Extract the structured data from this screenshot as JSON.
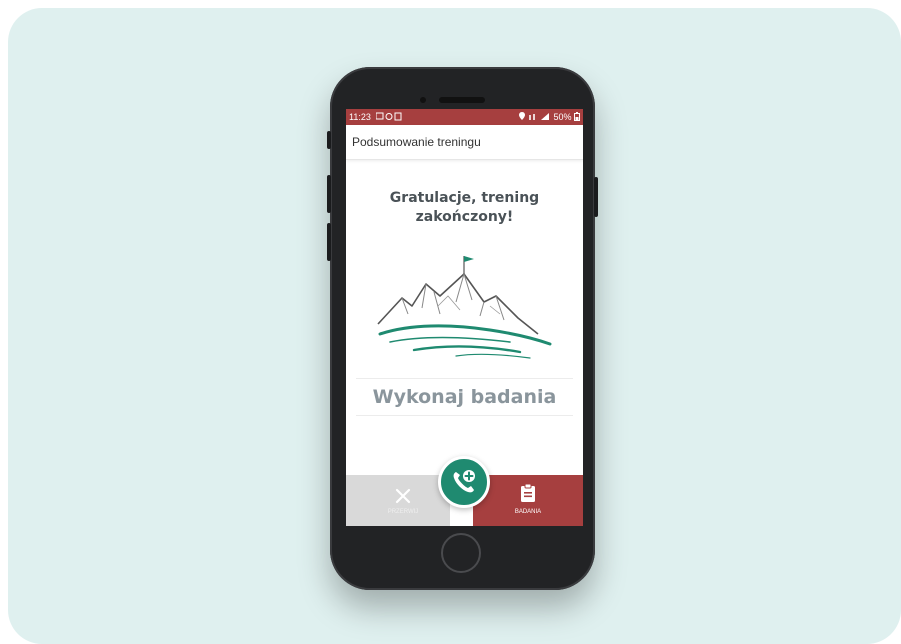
{
  "status_bar": {
    "time": "11:23",
    "battery": "50%"
  },
  "app_bar": {
    "title": "Podsumowanie treningu"
  },
  "main": {
    "headline_line1": "Gratulacje, trening",
    "headline_line2": "zakończony!",
    "illustration": "mountain-with-flag",
    "cta_label": "Wykonaj badania"
  },
  "bottom_bar": {
    "left_button_label": "PRZERWIJ",
    "left_icon": "close-icon",
    "right_button_label": "BADANIA",
    "right_icon": "clipboard-icon",
    "fab_icon": "phone-plus-icon"
  },
  "colors": {
    "background_card": "#dff0ef",
    "brand_red": "#a63f3f",
    "brand_green": "#1f8a70",
    "disabled_gray": "#d9d9d9"
  }
}
